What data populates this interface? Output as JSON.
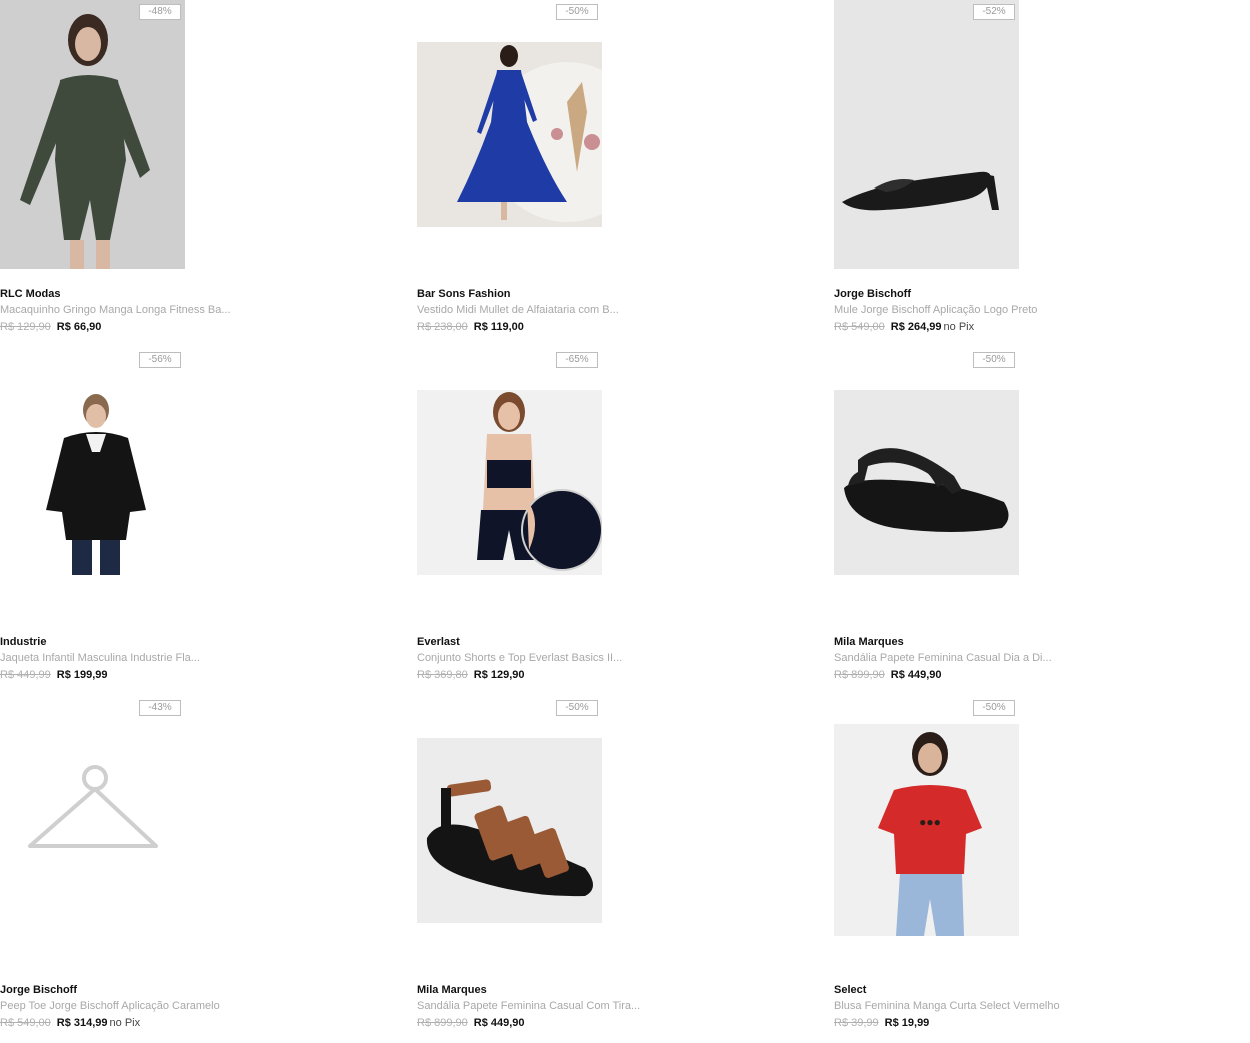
{
  "products": [
    {
      "discount": "-48%",
      "brand": "RLC Modas",
      "name": "Macaquinho Gringo Manga Longa Fitness Ba...",
      "old_price": "R$ 129,90",
      "price": "R$ 66,90",
      "pix": "",
      "image": "green-romper-photo"
    },
    {
      "discount": "-50%",
      "brand": "Bar Sons Fashion",
      "name": "Vestido Midi Mullet de Alfaiataria com B...",
      "old_price": "R$ 238,00",
      "price": "R$ 119,00",
      "pix": "",
      "image": "blue-dress-photo"
    },
    {
      "discount": "-52%",
      "brand": "Jorge Bischoff",
      "name": "Mule Jorge Bischoff Aplicação Logo Preto",
      "old_price": "R$ 549,00",
      "price": "R$ 264,99",
      "pix": "no Pix",
      "image": "black-mule-photo"
    },
    {
      "discount": "-56%",
      "brand": "Industrie",
      "name": "Jaqueta Infantil Masculina Industrie Fla...",
      "old_price": "R$ 449,99",
      "price": "R$ 199,99",
      "pix": "",
      "image": "black-puffer-jacket-photo"
    },
    {
      "discount": "-65%",
      "brand": "Everlast",
      "name": "Conjunto Shorts e Top Everlast Basics II...",
      "old_price": "R$ 369,80",
      "price": "R$ 129,90",
      "pix": "",
      "image": "sport-set-photo"
    },
    {
      "discount": "-50%",
      "brand": "Mila Marques",
      "name": "Sandália Papete Feminina Casual Dia a Di...",
      "old_price": "R$ 899,90",
      "price": "R$ 449,90",
      "pix": "",
      "image": "black-papete-photo"
    },
    {
      "discount": "-43%",
      "brand": "Jorge Bischoff",
      "name": "Peep Toe Jorge Bischoff Aplicação Caramelo",
      "old_price": "R$ 549,00",
      "price": "R$ 314,99",
      "pix": "no Pix",
      "image": "hanger-placeholder-icon"
    },
    {
      "discount": "-50%",
      "brand": "Mila Marques",
      "name": "Sandália Papete Feminina Casual Com Tira...",
      "old_price": "R$ 899,90",
      "price": "R$ 449,90",
      "pix": "",
      "image": "strap-papete-photo"
    },
    {
      "discount": "-50%",
      "brand": "Select",
      "name": "Blusa Feminina Manga Curta Select Vermelho",
      "old_price": "R$ 39,99",
      "price": "R$ 19,99",
      "pix": "",
      "image": "red-tshirt-photo"
    }
  ]
}
